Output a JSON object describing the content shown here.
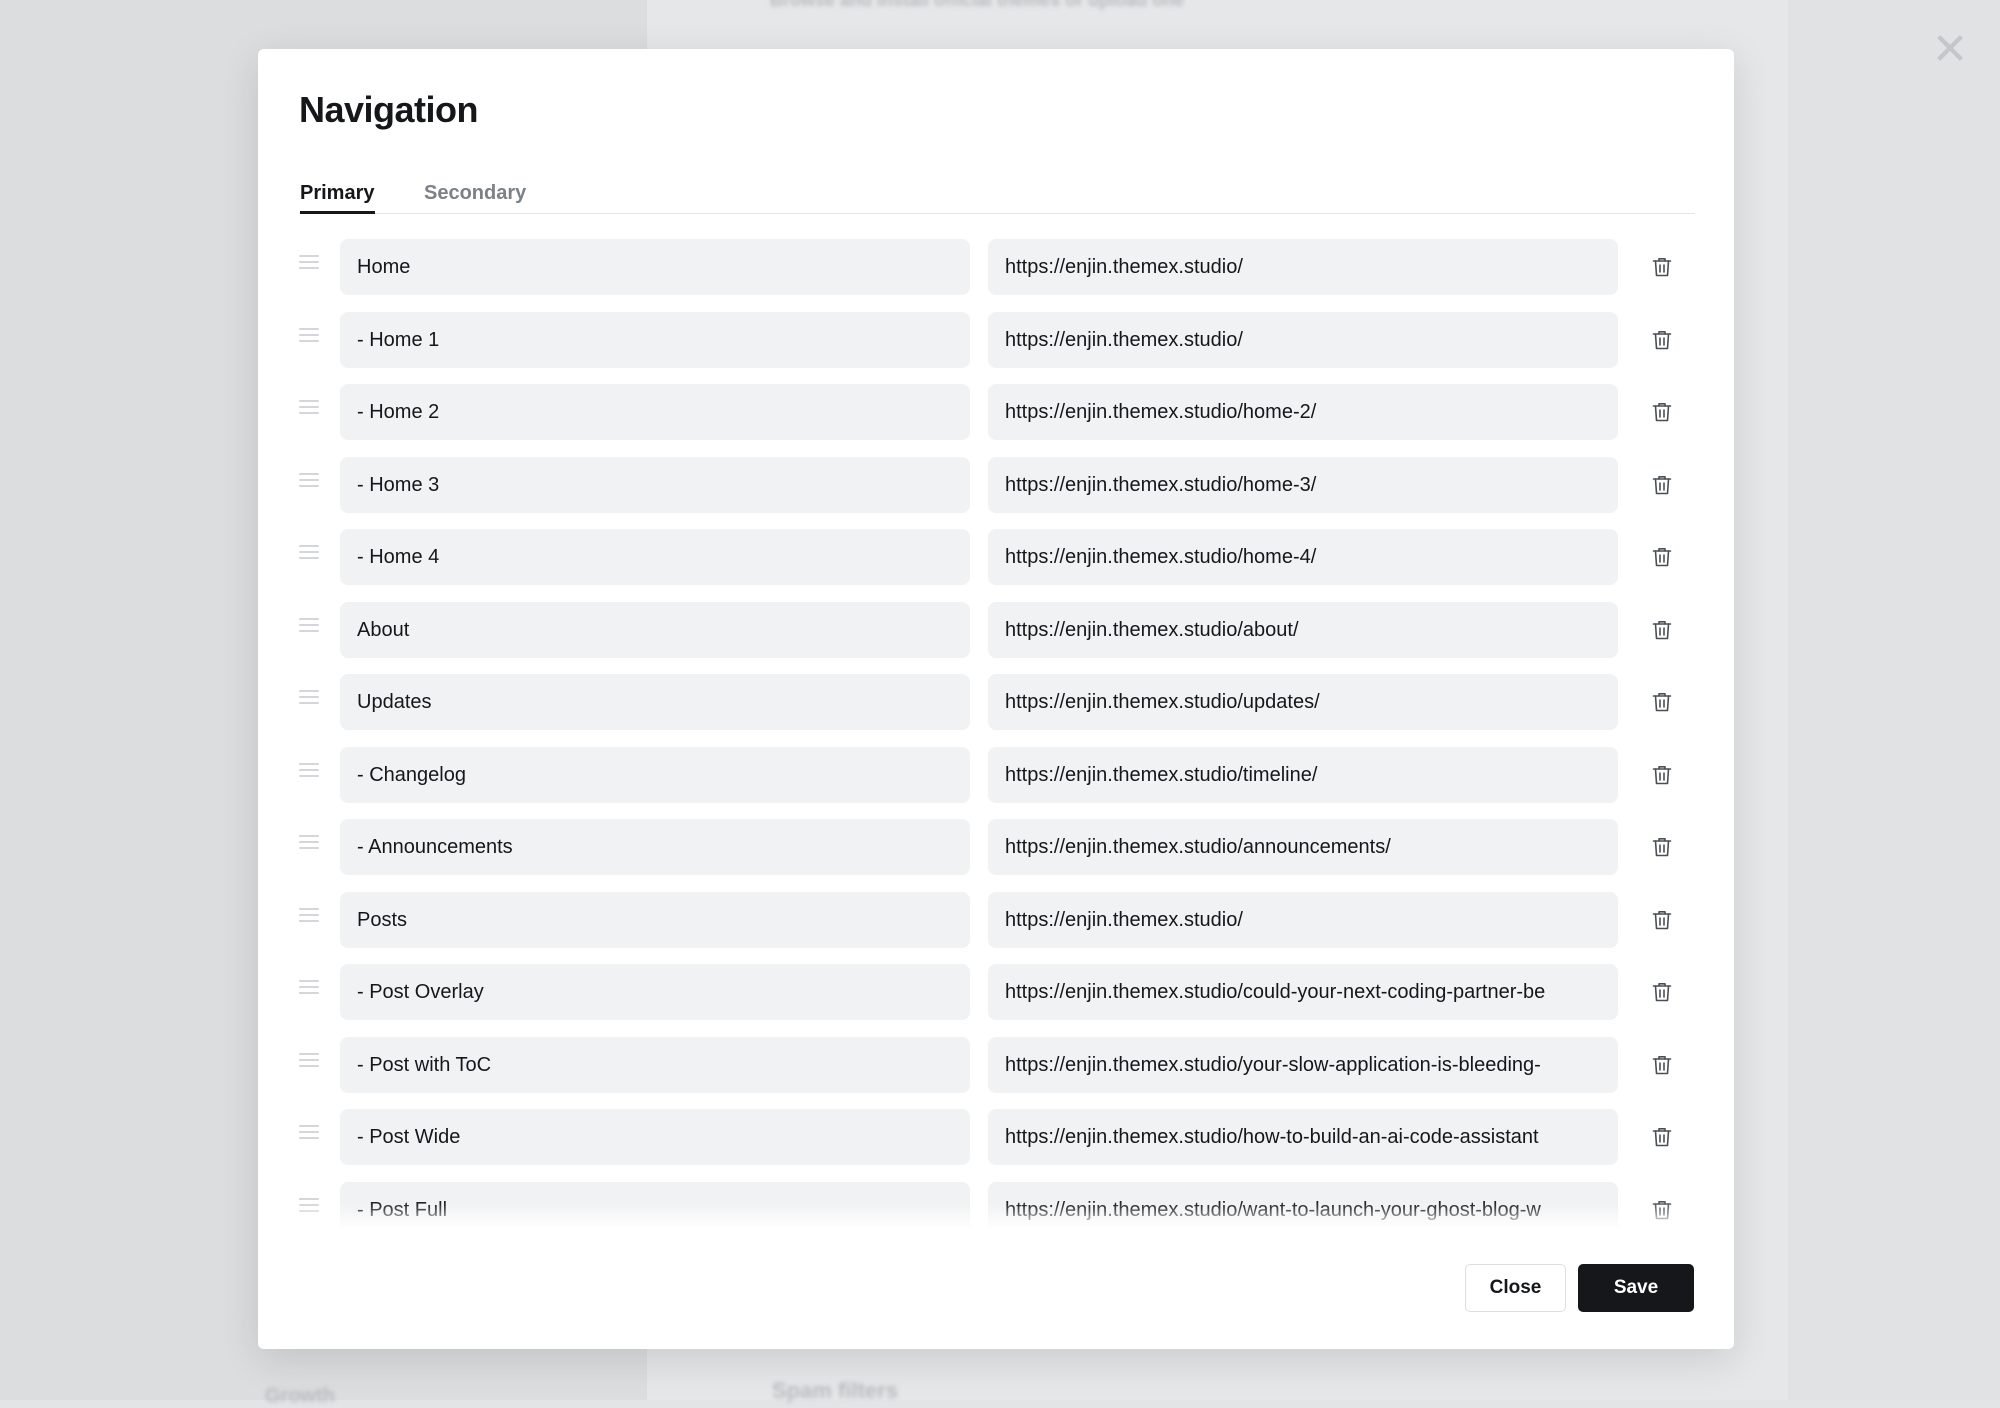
{
  "background": {
    "header_text": "Browse and install official themes or upload one",
    "left_item": "Growth",
    "section_label": "Spam filters"
  },
  "modal": {
    "title": "Navigation",
    "tabs": [
      {
        "label": "Primary",
        "active": true
      },
      {
        "label": "Secondary",
        "active": false
      }
    ],
    "items": [
      {
        "label": "Home",
        "url": "https://enjin.themex.studio/"
      },
      {
        "label": "- Home 1",
        "url": "https://enjin.themex.studio/"
      },
      {
        "label": "- Home 2",
        "url": "https://enjin.themex.studio/home-2/"
      },
      {
        "label": "- Home 3",
        "url": "https://enjin.themex.studio/home-3/"
      },
      {
        "label": "- Home 4",
        "url": "https://enjin.themex.studio/home-4/"
      },
      {
        "label": "About",
        "url": "https://enjin.themex.studio/about/"
      },
      {
        "label": "Updates",
        "url": "https://enjin.themex.studio/updates/"
      },
      {
        "label": "- Changelog",
        "url": "https://enjin.themex.studio/timeline/"
      },
      {
        "label": "- Announcements",
        "url": "https://enjin.themex.studio/announcements/"
      },
      {
        "label": "Posts",
        "url": "https://enjin.themex.studio/"
      },
      {
        "label": "- Post Overlay",
        "url": "https://enjin.themex.studio/could-your-next-coding-partner-be"
      },
      {
        "label": "- Post with ToC",
        "url": "https://enjin.themex.studio/your-slow-application-is-bleeding-"
      },
      {
        "label": "- Post Wide",
        "url": "https://enjin.themex.studio/how-to-build-an-ai-code-assistant"
      },
      {
        "label": "- Post Full",
        "url": "https://enjin.themex.studio/want-to-launch-your-ghost-blog-w"
      }
    ],
    "footer": {
      "close_label": "Close",
      "save_label": "Save"
    }
  },
  "icons": {
    "drag": "drag-handle-icon",
    "delete": "trash-icon",
    "dismiss": "close-icon"
  },
  "colors": {
    "primary_button": "#15171a",
    "field_background": "#f1f2f3"
  }
}
